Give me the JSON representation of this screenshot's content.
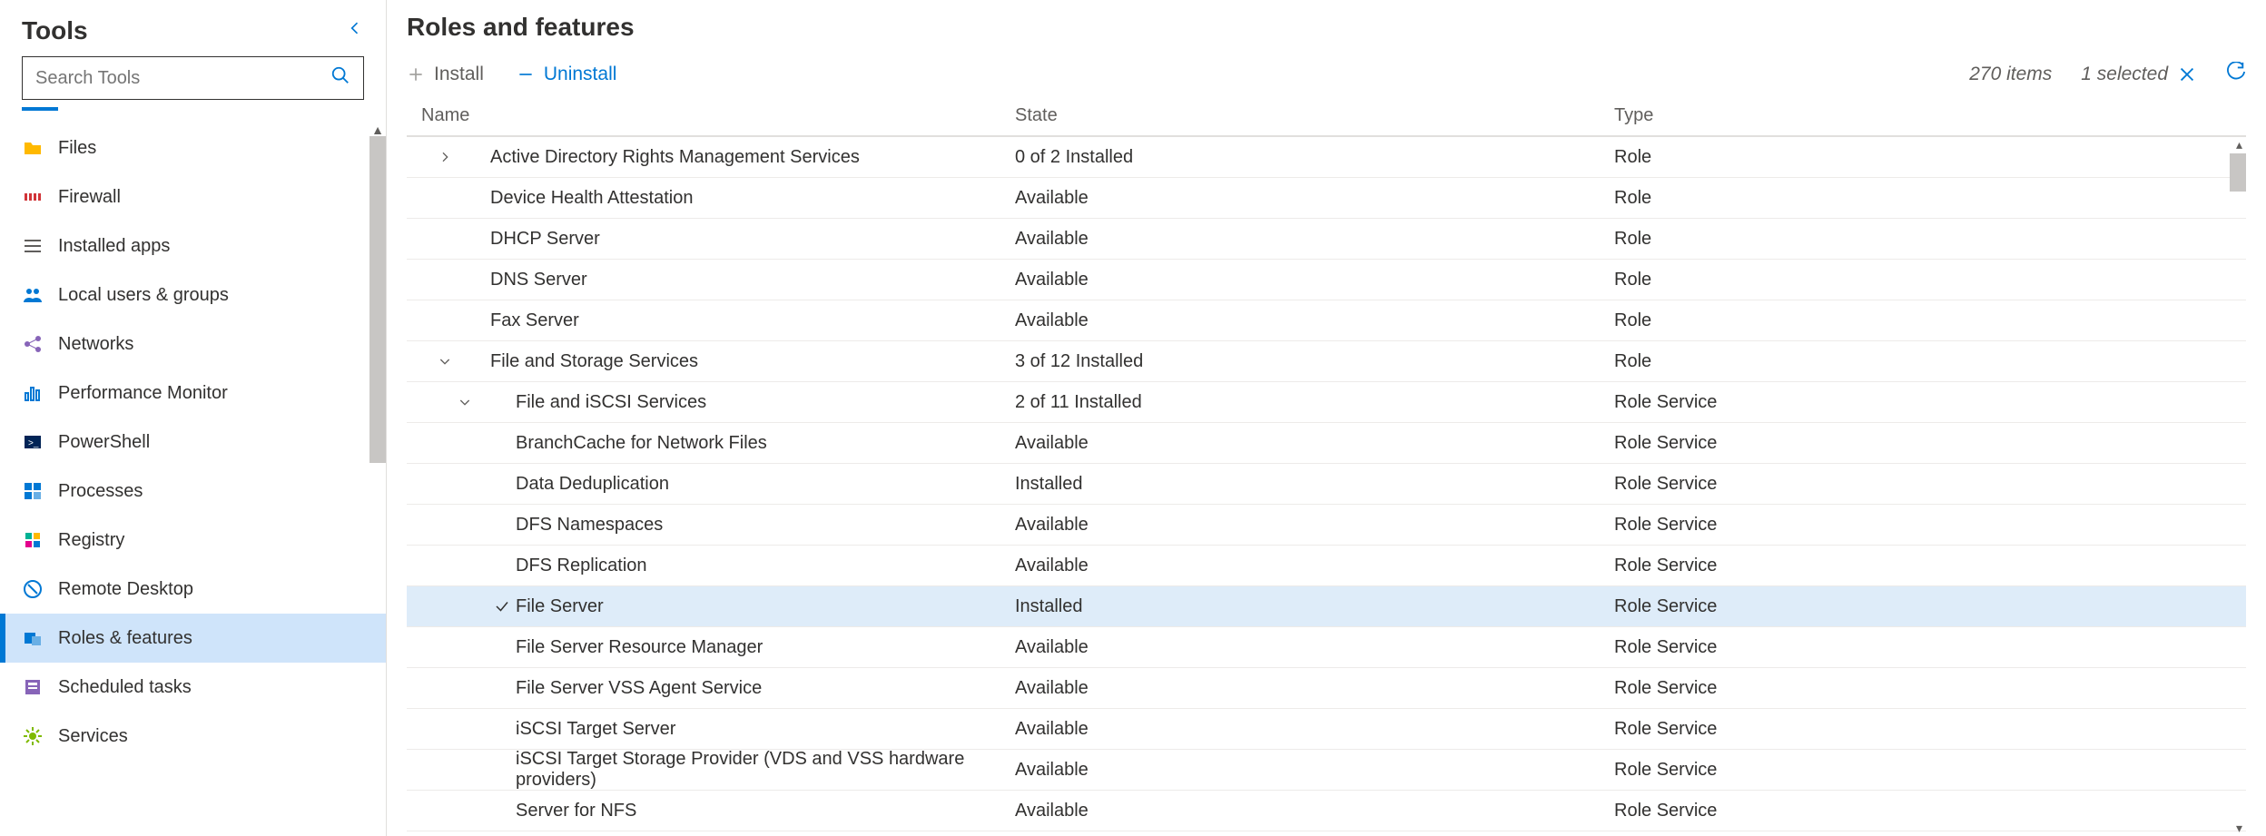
{
  "sidebar": {
    "title": "Tools",
    "search_placeholder": "Search Tools",
    "items": [
      {
        "label": "Files",
        "selected": false
      },
      {
        "label": "Firewall",
        "selected": false
      },
      {
        "label": "Installed apps",
        "selected": false
      },
      {
        "label": "Local users & groups",
        "selected": false
      },
      {
        "label": "Networks",
        "selected": false
      },
      {
        "label": "Performance Monitor",
        "selected": false
      },
      {
        "label": "PowerShell",
        "selected": false
      },
      {
        "label": "Processes",
        "selected": false
      },
      {
        "label": "Registry",
        "selected": false
      },
      {
        "label": "Remote Desktop",
        "selected": false
      },
      {
        "label": "Roles & features",
        "selected": true
      },
      {
        "label": "Scheduled tasks",
        "selected": false
      },
      {
        "label": "Services",
        "selected": false
      }
    ]
  },
  "main": {
    "title": "Roles and features",
    "install_label": "Install",
    "uninstall_label": "Uninstall",
    "count_label": "270 items",
    "selected_label": "1 selected",
    "columns": {
      "name": "Name",
      "state": "State",
      "type": "Type"
    },
    "rows": [
      {
        "indent": 1,
        "expand": "right",
        "check": false,
        "name": "Active Directory Rights Management Services",
        "state": "0 of 2 Installed",
        "type": "Role"
      },
      {
        "indent": 1,
        "expand": "",
        "check": false,
        "name": "Device Health Attestation",
        "state": "Available",
        "type": "Role"
      },
      {
        "indent": 1,
        "expand": "",
        "check": false,
        "name": "DHCP Server",
        "state": "Available",
        "type": "Role"
      },
      {
        "indent": 1,
        "expand": "",
        "check": false,
        "name": "DNS Server",
        "state": "Available",
        "type": "Role"
      },
      {
        "indent": 1,
        "expand": "",
        "check": false,
        "name": "Fax Server",
        "state": "Available",
        "type": "Role"
      },
      {
        "indent": 1,
        "expand": "down",
        "check": false,
        "name": "File and Storage Services",
        "state": "3 of 12 Installed",
        "type": "Role"
      },
      {
        "indent": 2,
        "expand": "down",
        "check": false,
        "name": "File and iSCSI Services",
        "state": "2 of 11 Installed",
        "type": "Role Service"
      },
      {
        "indent": 3,
        "expand": "",
        "check": false,
        "name": "BranchCache for Network Files",
        "state": "Available",
        "type": "Role Service"
      },
      {
        "indent": 3,
        "expand": "",
        "check": false,
        "name": "Data Deduplication",
        "state": "Installed",
        "type": "Role Service"
      },
      {
        "indent": 3,
        "expand": "",
        "check": false,
        "name": "DFS Namespaces",
        "state": "Available",
        "type": "Role Service"
      },
      {
        "indent": 3,
        "expand": "",
        "check": false,
        "name": "DFS Replication",
        "state": "Available",
        "type": "Role Service"
      },
      {
        "indent": 3,
        "expand": "",
        "check": true,
        "name": "File Server",
        "state": "Installed",
        "type": "Role Service",
        "selected": true
      },
      {
        "indent": 3,
        "expand": "",
        "check": false,
        "name": "File Server Resource Manager",
        "state": "Available",
        "type": "Role Service"
      },
      {
        "indent": 3,
        "expand": "",
        "check": false,
        "name": "File Server VSS Agent Service",
        "state": "Available",
        "type": "Role Service"
      },
      {
        "indent": 3,
        "expand": "",
        "check": false,
        "name": "iSCSI Target Server",
        "state": "Available",
        "type": "Role Service"
      },
      {
        "indent": 3,
        "expand": "",
        "check": false,
        "name": "iSCSI Target Storage Provider (VDS and VSS hardware providers)",
        "state": "Available",
        "type": "Role Service"
      },
      {
        "indent": 3,
        "expand": "",
        "check": false,
        "name": "Server for NFS",
        "state": "Available",
        "type": "Role Service"
      }
    ]
  }
}
